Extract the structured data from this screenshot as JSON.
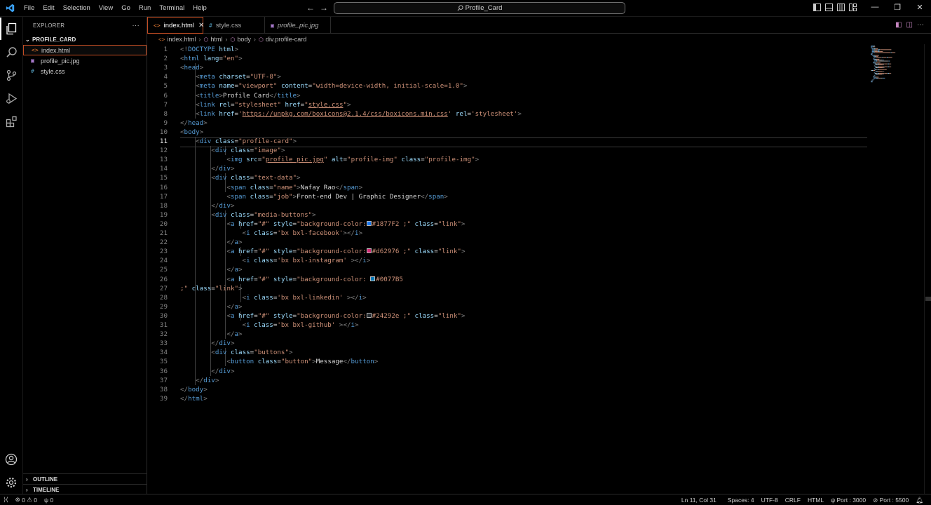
{
  "menu": [
    "File",
    "Edit",
    "Selection",
    "View",
    "Go",
    "Run",
    "Terminal",
    "Help"
  ],
  "command_center": {
    "text": "Profile_Card"
  },
  "explorer": {
    "title": "EXPLORER",
    "folder": "PROFILE_CARD",
    "files": [
      {
        "icon": "<>",
        "name": "index.html",
        "icon_color": "#e37933",
        "selected": true
      },
      {
        "icon": "▣",
        "name": "profile_pic.jpg",
        "icon_color": "#b180d7",
        "selected": false
      },
      {
        "icon": "#",
        "name": "style.css",
        "icon_color": "#519aba",
        "selected": false
      }
    ],
    "outline_label": "OUTLINE",
    "timeline_label": "TIMELINE"
  },
  "tabs": [
    {
      "icon": "<>",
      "label": "index.html",
      "icon_color": "#e37933",
      "active": true,
      "close": "✕"
    },
    {
      "icon": "#",
      "label": "style.css",
      "icon_color": "#519aba",
      "active": false
    },
    {
      "icon": "▣",
      "label": "profile_pic.jpg",
      "icon_color": "#b180d7",
      "active": false
    }
  ],
  "breadcrumb": [
    "index.html",
    "html",
    "body",
    "div.profile-card"
  ],
  "editor": {
    "current_line": 11
  },
  "status": {
    "errors": "0",
    "warnings": "0",
    "ports": "0",
    "position": "Ln 11, Col 31",
    "spaces": "Spaces: 4",
    "encoding": "UTF-8",
    "eol": "CRLF",
    "language": "HTML",
    "port1": "Port : 3000",
    "port2": "Port : 5500"
  },
  "colors": {
    "accent": "#c34d23",
    "tag": "#569cd6",
    "attr": "#9cdcfe",
    "string": "#ce9178"
  },
  "code_lines": [
    [
      [
        "p",
        "<!"
      ],
      [
        "t",
        "DOCTYPE"
      ],
      [
        "d",
        " "
      ],
      [
        "a",
        "html"
      ],
      [
        "p",
        ">"
      ]
    ],
    [
      [
        "p",
        "<"
      ],
      [
        "t",
        "html"
      ],
      [
        "d",
        " "
      ],
      [
        "a",
        "lang"
      ],
      [
        "d",
        "="
      ],
      [
        "s",
        "\"en\""
      ],
      [
        "p",
        ">"
      ]
    ],
    [
      [
        "p",
        "<"
      ],
      [
        "t",
        "head"
      ],
      [
        "p",
        ">"
      ]
    ],
    [
      [
        "d",
        "    "
      ],
      [
        "p",
        "<"
      ],
      [
        "t",
        "meta"
      ],
      [
        "d",
        " "
      ],
      [
        "a",
        "charset"
      ],
      [
        "d",
        "="
      ],
      [
        "s",
        "\"UTF-8\""
      ],
      [
        "p",
        ">"
      ]
    ],
    [
      [
        "d",
        "    "
      ],
      [
        "p",
        "<"
      ],
      [
        "t",
        "meta"
      ],
      [
        "d",
        " "
      ],
      [
        "a",
        "name"
      ],
      [
        "d",
        "="
      ],
      [
        "s",
        "\"viewport\""
      ],
      [
        "d",
        " "
      ],
      [
        "a",
        "content"
      ],
      [
        "d",
        "="
      ],
      [
        "s",
        "\"width=device-width, initial-scale=1.0\""
      ],
      [
        "p",
        ">"
      ]
    ],
    [
      [
        "d",
        "    "
      ],
      [
        "p",
        "<"
      ],
      [
        "t",
        "title"
      ],
      [
        "p",
        ">"
      ],
      [
        "d",
        "Profile Card"
      ],
      [
        "p",
        "</"
      ],
      [
        "t",
        "title"
      ],
      [
        "p",
        ">"
      ]
    ],
    [
      [
        "d",
        "    "
      ],
      [
        "p",
        "<"
      ],
      [
        "t",
        "link"
      ],
      [
        "d",
        " "
      ],
      [
        "a",
        "rel"
      ],
      [
        "d",
        "="
      ],
      [
        "s",
        "\"stylesheet\""
      ],
      [
        "d",
        " "
      ],
      [
        "a",
        "href"
      ],
      [
        "d",
        "="
      ],
      [
        "s",
        "\""
      ],
      [
        "u",
        "style.css"
      ],
      [
        "s",
        "\""
      ],
      [
        "p",
        ">"
      ]
    ],
    [
      [
        "d",
        "    "
      ],
      [
        "p",
        "<"
      ],
      [
        "t",
        "link"
      ],
      [
        "d",
        " "
      ],
      [
        "a",
        "href"
      ],
      [
        "d",
        "="
      ],
      [
        "s",
        "'"
      ],
      [
        "u",
        "https://unpkg.com/boxicons@2.1.4/css/boxicons.min.css"
      ],
      [
        "s",
        "'"
      ],
      [
        "d",
        " "
      ],
      [
        "a",
        "rel"
      ],
      [
        "d",
        "="
      ],
      [
        "s",
        "'stylesheet'"
      ],
      [
        "p",
        ">"
      ]
    ],
    [
      [
        "p",
        "</"
      ],
      [
        "t",
        "head"
      ],
      [
        "p",
        ">"
      ]
    ],
    [
      [
        "p",
        "<"
      ],
      [
        "t",
        "body"
      ],
      [
        "p",
        ">"
      ]
    ],
    [
      [
        "d",
        "    "
      ],
      [
        "p",
        "<"
      ],
      [
        "t",
        "div"
      ],
      [
        "d",
        " "
      ],
      [
        "a",
        "class"
      ],
      [
        "d",
        "="
      ],
      [
        "s",
        "\"profile-card\""
      ],
      [
        "p",
        ">"
      ]
    ],
    [
      [
        "d",
        "        "
      ],
      [
        "p",
        "<"
      ],
      [
        "t",
        "div"
      ],
      [
        "d",
        " "
      ],
      [
        "a",
        "class"
      ],
      [
        "d",
        "="
      ],
      [
        "s",
        "\"image\""
      ],
      [
        "p",
        ">"
      ]
    ],
    [
      [
        "d",
        "            "
      ],
      [
        "p",
        "<"
      ],
      [
        "t",
        "img"
      ],
      [
        "d",
        " "
      ],
      [
        "a",
        "src"
      ],
      [
        "d",
        "="
      ],
      [
        "s",
        "\""
      ],
      [
        "u",
        "profile_pic.jpg"
      ],
      [
        "s",
        "\""
      ],
      [
        "d",
        " "
      ],
      [
        "a",
        "alt"
      ],
      [
        "d",
        "="
      ],
      [
        "s",
        "\"profile-img\""
      ],
      [
        "d",
        " "
      ],
      [
        "a",
        "class"
      ],
      [
        "d",
        "="
      ],
      [
        "s",
        "\"profile-img\""
      ],
      [
        "p",
        ">"
      ]
    ],
    [
      [
        "d",
        "        "
      ],
      [
        "p",
        "</"
      ],
      [
        "t",
        "div"
      ],
      [
        "p",
        ">"
      ]
    ],
    [
      [
        "d",
        "        "
      ],
      [
        "p",
        "<"
      ],
      [
        "t",
        "div"
      ],
      [
        "d",
        " "
      ],
      [
        "a",
        "class"
      ],
      [
        "d",
        "="
      ],
      [
        "s",
        "\"text-data\""
      ],
      [
        "p",
        ">"
      ]
    ],
    [
      [
        "d",
        "            "
      ],
      [
        "p",
        "<"
      ],
      [
        "t",
        "span"
      ],
      [
        "d",
        " "
      ],
      [
        "a",
        "class"
      ],
      [
        "d",
        "="
      ],
      [
        "s",
        "\"name\""
      ],
      [
        "p",
        ">"
      ],
      [
        "d",
        "Nafay Rao"
      ],
      [
        "p",
        "</"
      ],
      [
        "t",
        "span"
      ],
      [
        "p",
        ">"
      ]
    ],
    [
      [
        "d",
        "            "
      ],
      [
        "p",
        "<"
      ],
      [
        "t",
        "span"
      ],
      [
        "d",
        " "
      ],
      [
        "a",
        "class"
      ],
      [
        "d",
        "="
      ],
      [
        "s",
        "\"job\""
      ],
      [
        "p",
        ">"
      ],
      [
        "d",
        "Front-end Dev | Graphic Designer"
      ],
      [
        "p",
        "</"
      ],
      [
        "t",
        "span"
      ],
      [
        "p",
        ">"
      ]
    ],
    [
      [
        "d",
        "        "
      ],
      [
        "p",
        "</"
      ],
      [
        "t",
        "div"
      ],
      [
        "p",
        ">"
      ]
    ],
    [
      [
        "d",
        "        "
      ],
      [
        "p",
        "<"
      ],
      [
        "t",
        "div"
      ],
      [
        "d",
        " "
      ],
      [
        "a",
        "class"
      ],
      [
        "d",
        "="
      ],
      [
        "s",
        "\"media-buttons\""
      ],
      [
        "p",
        ">"
      ]
    ],
    [
      [
        "d",
        "            "
      ],
      [
        "p",
        "<"
      ],
      [
        "t",
        "a"
      ],
      [
        "d",
        " "
      ],
      [
        "a",
        "href"
      ],
      [
        "d",
        "="
      ],
      [
        "s",
        "\"#\""
      ],
      [
        "d",
        " "
      ],
      [
        "a",
        "style"
      ],
      [
        "d",
        "="
      ],
      [
        "s",
        "\"background-color:"
      ],
      [
        "sw",
        "#1877F2"
      ],
      [
        "s",
        "#1877F2 ;\""
      ],
      [
        "d",
        " "
      ],
      [
        "a",
        "class"
      ],
      [
        "d",
        "="
      ],
      [
        "s",
        "\"link\""
      ],
      [
        "p",
        ">"
      ]
    ],
    [
      [
        "d",
        "                "
      ],
      [
        "p",
        "<"
      ],
      [
        "t",
        "i"
      ],
      [
        "d",
        " "
      ],
      [
        "a",
        "class"
      ],
      [
        "d",
        "="
      ],
      [
        "s",
        "'bx bxl-facebook'"
      ],
      [
        "p",
        "></"
      ],
      [
        "t",
        "i"
      ],
      [
        "p",
        ">"
      ]
    ],
    [
      [
        "d",
        "            "
      ],
      [
        "p",
        "</"
      ],
      [
        "t",
        "a"
      ],
      [
        "p",
        ">"
      ]
    ],
    [
      [
        "d",
        "            "
      ],
      [
        "p",
        "<"
      ],
      [
        "t",
        "a"
      ],
      [
        "d",
        " "
      ],
      [
        "a",
        "href"
      ],
      [
        "d",
        "="
      ],
      [
        "s",
        "\"#\""
      ],
      [
        "d",
        " "
      ],
      [
        "a",
        "style"
      ],
      [
        "d",
        "="
      ],
      [
        "s",
        "\"background-color:"
      ],
      [
        "sw",
        "#d62976"
      ],
      [
        "s",
        "#d62976 ;\""
      ],
      [
        "d",
        " "
      ],
      [
        "a",
        "class"
      ],
      [
        "d",
        "="
      ],
      [
        "s",
        "\"link\""
      ],
      [
        "p",
        ">"
      ]
    ],
    [
      [
        "d",
        "                "
      ],
      [
        "p",
        "<"
      ],
      [
        "t",
        "i"
      ],
      [
        "d",
        " "
      ],
      [
        "a",
        "class"
      ],
      [
        "d",
        "="
      ],
      [
        "s",
        "'bx bxl-instagram'"
      ],
      [
        "d",
        " "
      ],
      [
        "p",
        "></"
      ],
      [
        "t",
        "i"
      ],
      [
        "p",
        ">"
      ]
    ],
    [
      [
        "d",
        "            "
      ],
      [
        "p",
        "</"
      ],
      [
        "t",
        "a"
      ],
      [
        "p",
        ">"
      ]
    ],
    [
      [
        "d",
        "            "
      ],
      [
        "p",
        "<"
      ],
      [
        "t",
        "a"
      ],
      [
        "d",
        " "
      ],
      [
        "a",
        "href"
      ],
      [
        "d",
        "="
      ],
      [
        "s",
        "\"#\""
      ],
      [
        "d",
        " "
      ],
      [
        "a",
        "style"
      ],
      [
        "d",
        "="
      ],
      [
        "s",
        "\"background-color: "
      ],
      [
        "sw",
        "#0077B5"
      ],
      [
        "s",
        "#0077B5"
      ]
    ],
    [
      [
        "s",
        ";\""
      ],
      [
        "d",
        " "
      ],
      [
        "a",
        "class"
      ],
      [
        "d",
        "="
      ],
      [
        "s",
        "\"link\""
      ],
      [
        "p",
        ">"
      ]
    ],
    [
      [
        "d",
        "                "
      ],
      [
        "p",
        "<"
      ],
      [
        "t",
        "i"
      ],
      [
        "d",
        " "
      ],
      [
        "a",
        "class"
      ],
      [
        "d",
        "="
      ],
      [
        "s",
        "'bx bxl-linkedin'"
      ],
      [
        "d",
        " "
      ],
      [
        "p",
        "></"
      ],
      [
        "t",
        "i"
      ],
      [
        "p",
        ">"
      ]
    ],
    [
      [
        "d",
        "            "
      ],
      [
        "p",
        "</"
      ],
      [
        "t",
        "a"
      ],
      [
        "p",
        ">"
      ]
    ],
    [
      [
        "d",
        "            "
      ],
      [
        "p",
        "<"
      ],
      [
        "t",
        "a"
      ],
      [
        "d",
        " "
      ],
      [
        "a",
        "href"
      ],
      [
        "d",
        "="
      ],
      [
        "s",
        "\"#\""
      ],
      [
        "d",
        " "
      ],
      [
        "a",
        "style"
      ],
      [
        "d",
        "="
      ],
      [
        "s",
        "\"background-color:"
      ],
      [
        "sw",
        "#24292e"
      ],
      [
        "s",
        "#24292e ;\""
      ],
      [
        "d",
        " "
      ],
      [
        "a",
        "class"
      ],
      [
        "d",
        "="
      ],
      [
        "s",
        "\"link\""
      ],
      [
        "p",
        ">"
      ]
    ],
    [
      [
        "d",
        "                "
      ],
      [
        "p",
        "<"
      ],
      [
        "t",
        "i"
      ],
      [
        "d",
        " "
      ],
      [
        "a",
        "class"
      ],
      [
        "d",
        "="
      ],
      [
        "s",
        "'bx bxl-github'"
      ],
      [
        "d",
        " "
      ],
      [
        "p",
        "></"
      ],
      [
        "t",
        "i"
      ],
      [
        "p",
        ">"
      ]
    ],
    [
      [
        "d",
        "            "
      ],
      [
        "p",
        "</"
      ],
      [
        "t",
        "a"
      ],
      [
        "p",
        ">"
      ]
    ],
    [
      [
        "d",
        "        "
      ],
      [
        "p",
        "</"
      ],
      [
        "t",
        "div"
      ],
      [
        "p",
        ">"
      ]
    ],
    [
      [
        "d",
        "        "
      ],
      [
        "p",
        "<"
      ],
      [
        "t",
        "div"
      ],
      [
        "d",
        " "
      ],
      [
        "a",
        "class"
      ],
      [
        "d",
        "="
      ],
      [
        "s",
        "\"buttons\""
      ],
      [
        "p",
        ">"
      ]
    ],
    [
      [
        "d",
        "            "
      ],
      [
        "p",
        "<"
      ],
      [
        "t",
        "button"
      ],
      [
        "d",
        " "
      ],
      [
        "a",
        "class"
      ],
      [
        "d",
        "="
      ],
      [
        "s",
        "\"button\""
      ],
      [
        "p",
        ">"
      ],
      [
        "d",
        "Message"
      ],
      [
        "p",
        "</"
      ],
      [
        "t",
        "button"
      ],
      [
        "p",
        ">"
      ]
    ],
    [
      [
        "d",
        "        "
      ],
      [
        "p",
        "</"
      ],
      [
        "t",
        "div"
      ],
      [
        "p",
        ">"
      ]
    ],
    [
      [
        "d",
        "    "
      ],
      [
        "p",
        "</"
      ],
      [
        "t",
        "div"
      ],
      [
        "p",
        ">"
      ]
    ],
    [
      [
        "p",
        "</"
      ],
      [
        "t",
        "body"
      ],
      [
        "p",
        ">"
      ]
    ],
    [
      [
        "p",
        "</"
      ],
      [
        "t",
        "html"
      ],
      [
        "p",
        ">"
      ]
    ]
  ]
}
